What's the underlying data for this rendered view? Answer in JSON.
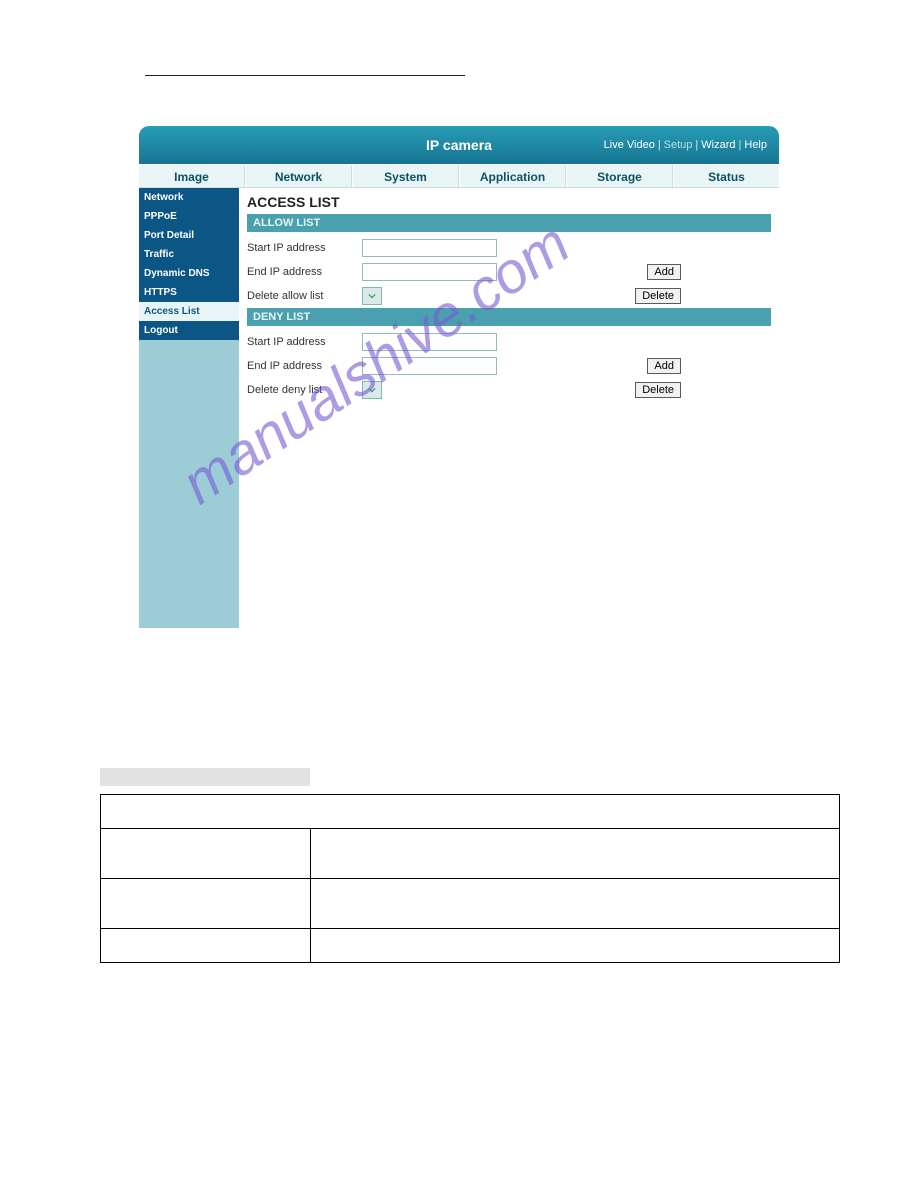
{
  "header": {
    "title": "IP camera",
    "links": {
      "live": "Live Video",
      "setup": "Setup",
      "wizard": "Wizard",
      "help": "Help"
    }
  },
  "tabs": [
    "Image",
    "Network",
    "System",
    "Application",
    "Storage",
    "Status"
  ],
  "sidebar": {
    "top": [
      "Network",
      "PPPoE",
      "Port Detail",
      "Traffic",
      "Dynamic DNS",
      "HTTPS"
    ],
    "active": "Access List",
    "bottom": [
      "Logout"
    ]
  },
  "main": {
    "title": "ACCESS LIST",
    "allow": {
      "section": "ALLOW LIST",
      "start_label": "Start IP address",
      "end_label": "End IP address",
      "delete_label": "Delete allow list",
      "add_btn": "Add",
      "delete_btn": "Delete"
    },
    "deny": {
      "section": "DENY LIST",
      "start_label": "Start IP address",
      "end_label": "End IP address",
      "delete_label": "Delete deny list",
      "add_btn": "Add",
      "delete_btn": "Delete"
    }
  },
  "watermark": "manualshive.com"
}
